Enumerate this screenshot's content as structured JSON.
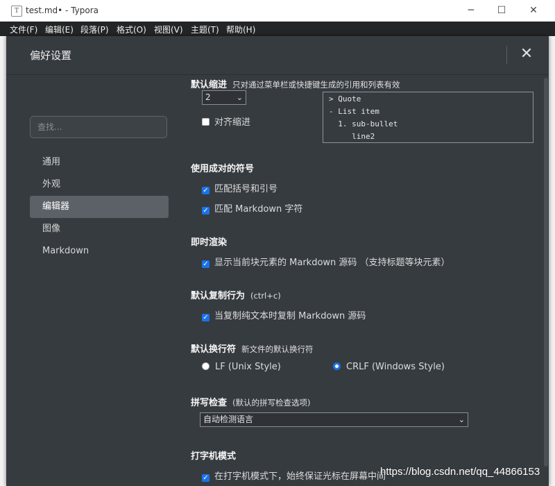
{
  "window": {
    "app_icon": "T",
    "title": "test.md• - Typora",
    "minimize": "─",
    "maximize": "☐",
    "close": "✕"
  },
  "menu": [
    "文件(F)",
    "编辑(E)",
    "段落(P)",
    "格式(O)",
    "视图(V)",
    "主题(T)",
    "帮助(H)"
  ],
  "dialog": {
    "title": "偏好设置",
    "close": "✕",
    "search_placeholder": "查找...",
    "nav": [
      "通用",
      "外观",
      "编辑器",
      "图像",
      "Markdown"
    ],
    "active_nav": "编辑器"
  },
  "sections": {
    "indent": {
      "title": "默认缩进",
      "note": "只对通过菜单栏或快捷键生成的引用和列表有效",
      "select_value": "2",
      "align_label": "对齐缩进",
      "align_checked": false,
      "preview": [
        "> Quote",
        "- List item",
        "  1. sub-bullet",
        "     line2"
      ]
    },
    "pairs": {
      "title": "使用成对的符号",
      "opt1": "匹配括号和引号",
      "opt2": "匹配 Markdown 字符"
    },
    "live": {
      "title": "即时渲染",
      "opt1": "显示当前块元素的 Markdown 源码 （支持标题等块元素）"
    },
    "copy": {
      "title": "默认复制行为",
      "note": "(ctrl+c)",
      "opt1": "当复制纯文本时复制 Markdown 源码"
    },
    "newline": {
      "title": "默认换行符",
      "note": "新文件的默认换行符",
      "lf": "LF (Unix Style)",
      "crlf": "CRLF (Windows Style)",
      "selected": "CRLF"
    },
    "spell": {
      "title": "拼写检查",
      "note": "(默认的拼写检查选项)",
      "select_value": "自动检测语言"
    },
    "typewriter": {
      "title": "打字机模式",
      "opt1": "在打字机模式下，始终保证光标在屏幕中间"
    }
  },
  "watermark": "https://blog.csdn.net/qq_44866153",
  "colors": {
    "accent": "#1a73e8",
    "dialog_bg": "#363b40",
    "active_nav_bg": "#5b6167"
  }
}
